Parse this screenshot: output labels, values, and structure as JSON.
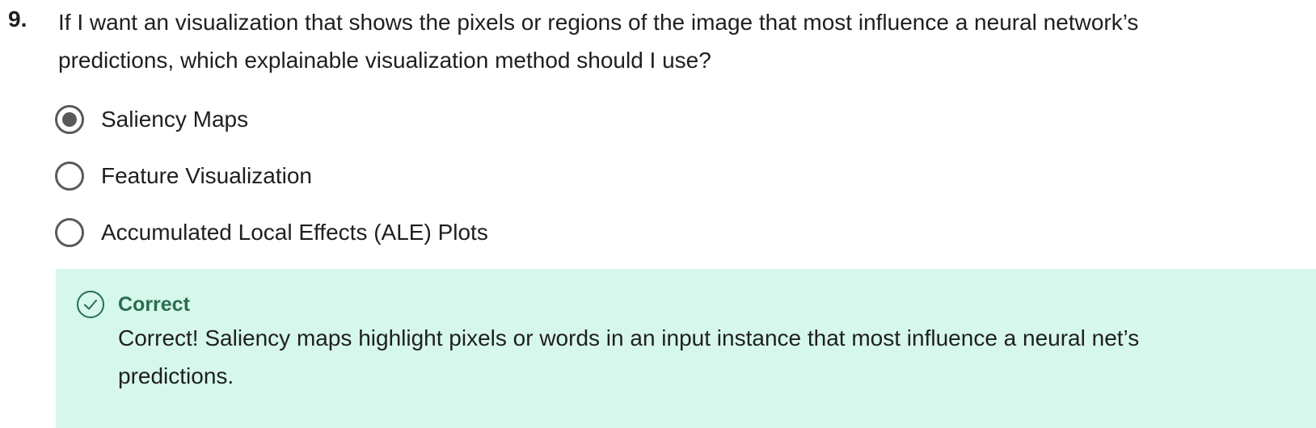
{
  "question": {
    "number": "9.",
    "text": "If I want an visualization that shows the pixels or regions of the image that most influence a neural network’s predictions, which explainable visualization method should I use?"
  },
  "options": [
    {
      "label": "Saliency Maps",
      "selected": true
    },
    {
      "label": "Feature Visualization",
      "selected": false
    },
    {
      "label": "Accumulated Local Effects (ALE) Plots",
      "selected": false
    }
  ],
  "feedback": {
    "status": "Correct",
    "message": "Correct! Saliency maps highlight pixels or words in an input instance that most influence a neural net’s predictions.",
    "icon": "check-circle-icon",
    "background_color": "#d6f7ec",
    "accent_color": "#2a6e4f"
  }
}
